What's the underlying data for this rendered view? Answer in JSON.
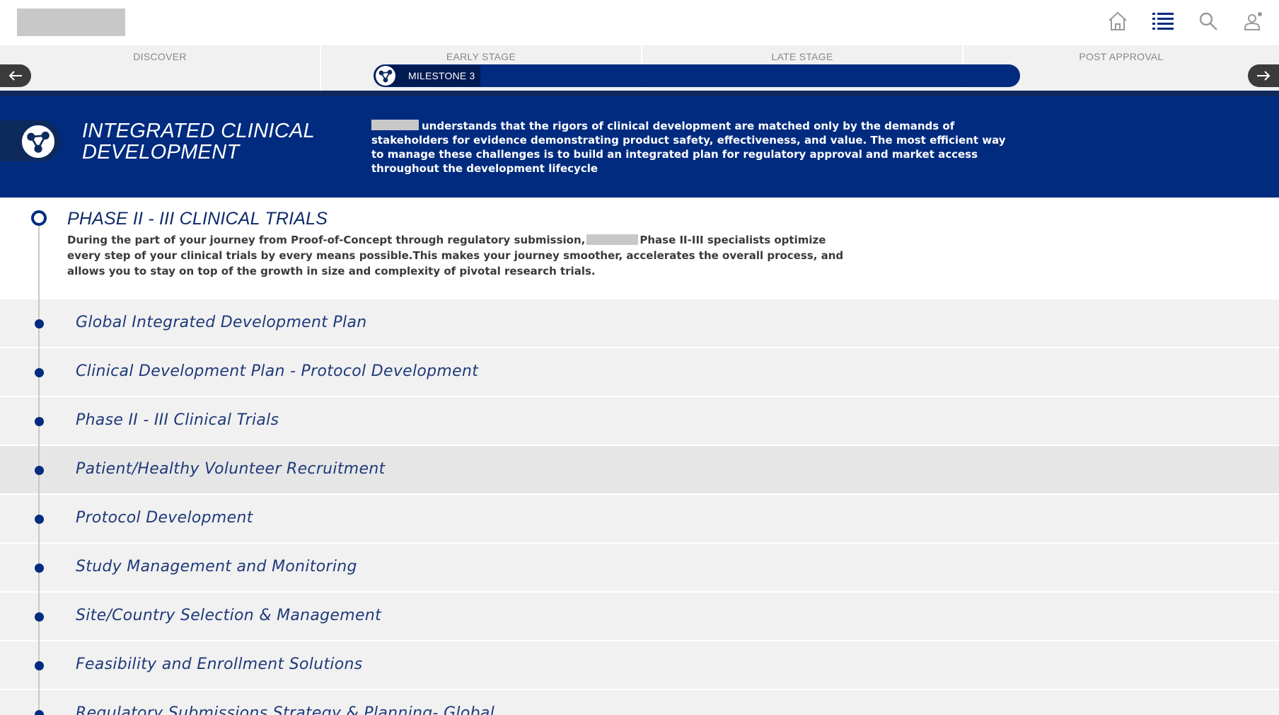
{
  "header": {
    "icons": [
      "home-icon",
      "list-icon",
      "search-icon",
      "user-icon"
    ]
  },
  "stages": {
    "items": [
      {
        "label": "DISCOVER"
      },
      {
        "label": "EARLY STAGE"
      },
      {
        "label": "LATE STAGE"
      },
      {
        "label": "POST APPROVAL"
      }
    ],
    "milestone_label": "MILESTONE 3"
  },
  "hero": {
    "title": "INTEGRATED CLINICAL DEVELOPMENT",
    "description": "understands that the rigors of clinical development are matched only by the demands of stakeholders for evidence demonstrating product safety, effectiveness, and value. The most efficient way to manage these challenges is to build an integrated plan for regulatory approval and market access throughout the development lifecycle"
  },
  "phase": {
    "title": "PHASE II - III CLINICAL TRIALS",
    "description_part1": "During the part of your journey from Proof-of-Concept through regulatory submission,",
    "description_part2": "Phase II-III specialists optimize every step of your clinical trials by every means possible.This makes your journey smoother, accelerates the overall process, and allows you to stay on top of the growth in size and complexity of pivotal research trials."
  },
  "list": {
    "items": [
      {
        "label": "Global Integrated Development Plan"
      },
      {
        "label": "Clinical Development Plan - Protocol Development"
      },
      {
        "label": "Phase II - III Clinical Trials"
      },
      {
        "label": "Patient/Healthy Volunteer Recruitment"
      },
      {
        "label": "Protocol Development"
      },
      {
        "label": "Study Management and Monitoring"
      },
      {
        "label": "Site/Country Selection & Management"
      },
      {
        "label": "Feasibility and Enrollment Solutions"
      },
      {
        "label": "Regulatory Submissions Strategy & Planning- Global"
      }
    ]
  },
  "colors": {
    "brand_navy": "#002b7f",
    "dark_navy": "#0e2a5c",
    "list_bg": "#f1f1f1",
    "list_bg_active": "#e6e6e6"
  }
}
